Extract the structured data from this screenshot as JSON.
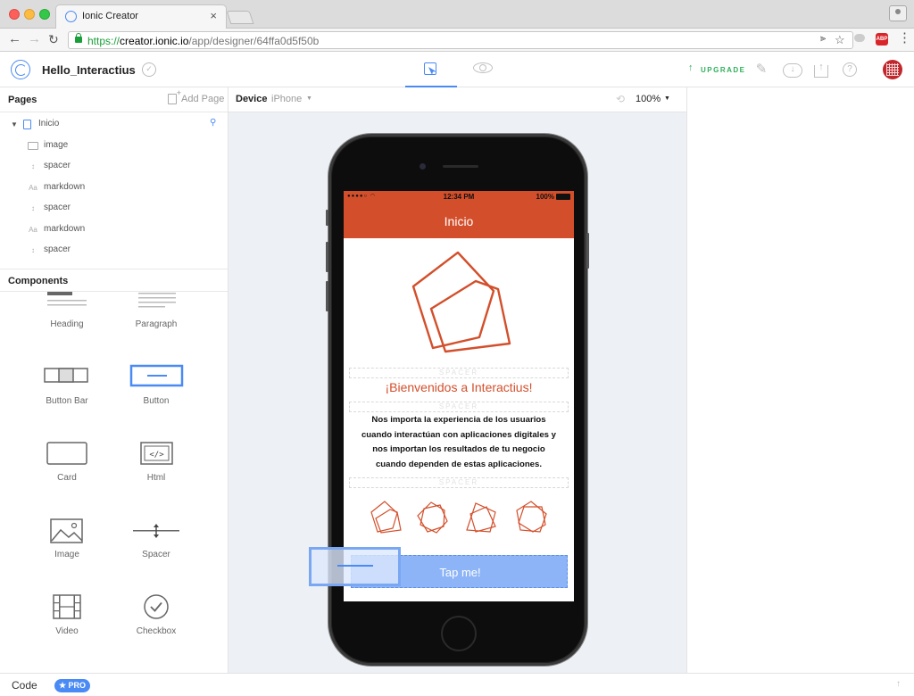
{
  "browser": {
    "tab_title": "Ionic Creator",
    "tab_close": "×",
    "url_scheme": "https://",
    "url_host": "creator.ionic.io",
    "url_path": "/app/designer/64ffa0d5f50b",
    "adblock_label": "ABP"
  },
  "header": {
    "project_name": "Hello_Interactius",
    "upgrade_label": "UPGRADE"
  },
  "pages_panel": {
    "title": "Pages",
    "add_page_label": "Add Page",
    "tree": [
      {
        "label": "Inicio",
        "icon": "page-icon"
      },
      {
        "label": "image",
        "icon": "image-node-icon"
      },
      {
        "label": "spacer",
        "icon": "spacer-node-icon"
      },
      {
        "label": "markdown",
        "icon": "markdown-node-icon"
      },
      {
        "label": "spacer",
        "icon": "spacer-node-icon"
      },
      {
        "label": "markdown",
        "icon": "markdown-node-icon"
      },
      {
        "label": "spacer",
        "icon": "spacer-node-icon"
      }
    ]
  },
  "components_panel": {
    "title": "Components",
    "items": [
      {
        "label": "Heading"
      },
      {
        "label": "Paragraph"
      },
      {
        "label": "Button Bar"
      },
      {
        "label": "Button"
      },
      {
        "label": "Card"
      },
      {
        "label": "Html"
      },
      {
        "label": "Image"
      },
      {
        "label": "Spacer"
      },
      {
        "label": "Video"
      },
      {
        "label": "Checkbox"
      }
    ]
  },
  "canvas": {
    "device_label": "Device",
    "device_value": "iPhone",
    "zoom": "100%"
  },
  "phone": {
    "status_time": "12:34 PM",
    "status_battery": "100%",
    "nav_title": "Inicio",
    "spacer_label": "SPACER",
    "welcome": "¡Bienvenidos a Interactius!",
    "paragraph_lines": [
      "Nos importa la experiencia de los usuarios",
      "cuando interactúan con aplicaciones digitales y",
      "nos importan los resultados de tu negocio",
      "cuando dependen de estas aplicaciones."
    ],
    "button_label": "Tap me!"
  },
  "bottom": {
    "code_label": "Code",
    "pro_label": "★ PRO"
  },
  "colors": {
    "accent": "#4a8af4",
    "brand": "#d34f2b",
    "upgrade": "#2fb05a"
  }
}
